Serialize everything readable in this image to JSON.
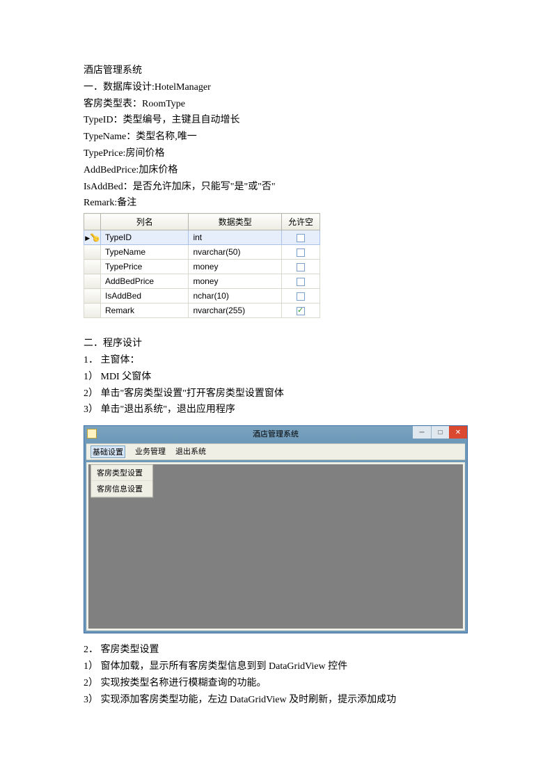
{
  "title": "酒店管理系统",
  "section1": {
    "heading": "一．数据库设计:HotelManager",
    "line1": "客房类型表：RoomType",
    "line2": "TypeID：类型编号，主键且自动增长",
    "line3": "TypeName：类型名称,唯一",
    "line4": "TypePrice:房间价格",
    "line5": "AddBedPrice:加床价格",
    "line6": "IsAddBed：是否允许加床，只能写\"是\"或\"否\"",
    "line7": "Remark:备注"
  },
  "db_table": {
    "headers": [
      "列名",
      "数据类型",
      "允许空"
    ],
    "rows": [
      {
        "name": "TypeID",
        "type": "int",
        "allow_null": false,
        "pk": true
      },
      {
        "name": "TypeName",
        "type": "nvarchar(50)",
        "allow_null": false,
        "pk": false
      },
      {
        "name": "TypePrice",
        "type": "money",
        "allow_null": false,
        "pk": false
      },
      {
        "name": "AddBedPrice",
        "type": "money",
        "allow_null": false,
        "pk": false
      },
      {
        "name": "IsAddBed",
        "type": "nchar(10)",
        "allow_null": false,
        "pk": false
      },
      {
        "name": "Remark",
        "type": "nvarchar(255)",
        "allow_null": true,
        "pk": false
      }
    ]
  },
  "section2": {
    "heading": "二．程序设计",
    "s1": "1． 主窗体：",
    "s1_1": "1） MDI 父窗体",
    "s1_2": "2） 单击\"客房类型设置\"打开客房类型设置窗体",
    "s1_3": "3） 单击\"退出系统\"，退出应用程序"
  },
  "app_window": {
    "title": "酒店管理系统",
    "menu": [
      "基础设置",
      "业务管理",
      "退出系统"
    ],
    "dropdown": [
      "客房类型设置",
      "客房信息设置"
    ]
  },
  "section3": {
    "s2": "2． 客房类型设置",
    "s2_1": "1） 窗体加载，显示所有客房类型信息到到 DataGridView 控件",
    "s2_2": "2） 实现按类型名称进行模糊查询的功能。",
    "s2_3": "3） 实现添加客房类型功能，左边 DataGridView 及时刷新，提示添加成功"
  }
}
